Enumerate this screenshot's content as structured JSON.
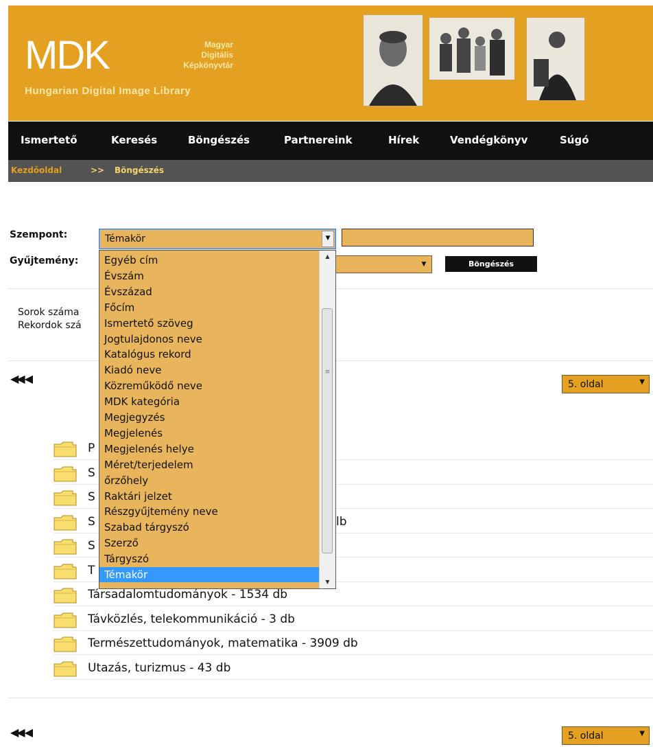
{
  "brand": {
    "logo": "MDK",
    "sub_lines": [
      "Magyar",
      "Digitális",
      "Képkönyvtár"
    ],
    "english": "Hungarian Digital Image Library",
    "accent": "#E3A021"
  },
  "nav": {
    "items": [
      "Ismertető",
      "Keresés",
      "Böngészés",
      "Partnereink",
      "Hírek",
      "Vendégkönyv",
      "Súgó"
    ]
  },
  "breadcrumb": {
    "home": "Kezdőoldal",
    "separator": ">>",
    "current": "Böngészés"
  },
  "form": {
    "aspect_label": "Szempont:",
    "aspect_value": "Témakör",
    "collection_label": "Gyűjtemény:",
    "collection_value": "",
    "text_value": "",
    "browse_button": "Böngészés"
  },
  "info": {
    "rows_label": "Sorok száma",
    "records_label": "Rekordok szá"
  },
  "pager": {
    "arrows": "◀◀ ◀",
    "page_value": "5. oldal"
  },
  "list": [
    {
      "prefix": "P",
      "text": ""
    },
    {
      "prefix": "S",
      "text": ""
    },
    {
      "prefix": "S",
      "text": ""
    },
    {
      "prefix": "S",
      "text": "lb"
    },
    {
      "prefix": "S",
      "text": ""
    },
    {
      "prefix": "T",
      "text": ""
    },
    {
      "prefix": "",
      "text": "Társadalomtudományok - 1534 db"
    },
    {
      "prefix": "",
      "text": "Távközlés, telekommunikáció - 3 db"
    },
    {
      "prefix": "",
      "text": "Természettudományok, matematika - 3909 db"
    },
    {
      "prefix": "",
      "text": "Utazás, turizmus - 43 db"
    }
  ],
  "dropdown": {
    "options": [
      "Egyéb cím",
      "Évszám",
      "Évszázad",
      "Főcím",
      "Ismertető szöveg",
      "Jogtulajdonos neve",
      "Katalógus rekord",
      "Kiadó neve",
      "Közreműködő neve",
      "MDK kategória",
      "Megjegyzés",
      "Megjelenés",
      "Megjelenés helye",
      "Méret/terjedelem",
      "őrzőhely",
      "Raktári jelzet",
      "Részgyűjtemény neve",
      "Szabad tárgyszó",
      "Szerző",
      "Tárgyszó",
      "Témakör"
    ],
    "selected": "Témakör"
  }
}
